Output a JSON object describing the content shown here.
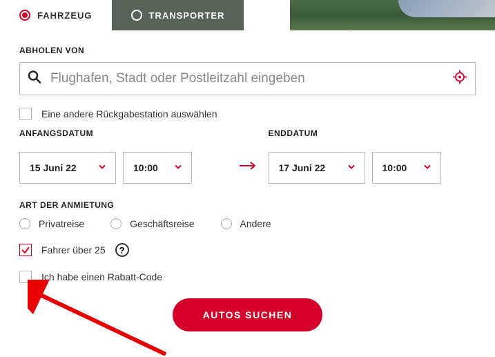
{
  "tabs": {
    "vehicle": "FAHRZEUG",
    "van": "TRANSPORTER"
  },
  "pickup": {
    "label": "ABHOLEN VON",
    "placeholder": "Flughafen, Stadt oder Postleitzahl eingeben"
  },
  "otherReturn": "Eine andere Rückgabestation auswählen",
  "startDate": {
    "label": "ANFANGSDATUM",
    "date": "15 Juni 22",
    "time": "10:00"
  },
  "endDate": {
    "label": "ENDDATUM",
    "date": "17 Juni 22",
    "time": "10:00"
  },
  "rentalType": {
    "label": "ART DER ANMIETUNG",
    "options": {
      "private": "Privatreise",
      "business": "Geschäftsreise",
      "other": "Andere"
    }
  },
  "driverOver25": "Fahrer über 25",
  "helpGlyph": "?",
  "discountCode": "Ich habe einen Rabatt-Code",
  "submit": "AUTOS SUCHEN",
  "colors": {
    "brand": "#d4002a"
  }
}
